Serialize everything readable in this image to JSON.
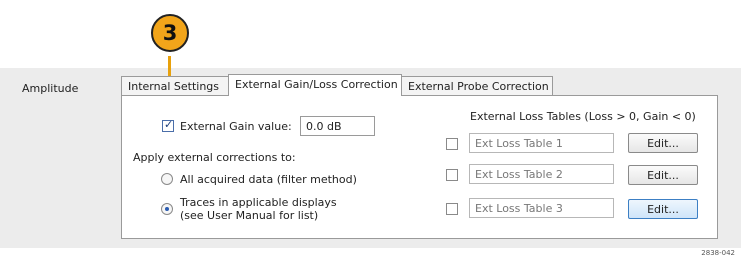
{
  "callout": {
    "number": "3"
  },
  "section": {
    "label": "Amplitude"
  },
  "tabs": [
    {
      "label": "Internal Settings"
    },
    {
      "label": "External Gain/Loss Correction"
    },
    {
      "label": "External Probe Correction"
    }
  ],
  "gain": {
    "checkbox_label": "External Gain value:",
    "value": "0.0 dB",
    "checked": true
  },
  "apply": {
    "heading": "Apply external corrections to:",
    "options": [
      {
        "label": "All acquired data (filter method)",
        "selected": false
      },
      {
        "label_line1": "Traces in applicable displays",
        "label_line2": "(see User Manual for list)",
        "selected": true
      }
    ]
  },
  "loss_tables": {
    "heading": "External Loss Tables (Loss > 0, Gain < 0)",
    "rows": [
      {
        "name": "Ext Loss Table 1",
        "button": "Edit..."
      },
      {
        "name": "Ext Loss Table 2",
        "button": "Edit..."
      },
      {
        "name": "Ext Loss Table 3",
        "button": "Edit..."
      }
    ]
  },
  "figure_id": "2838-042"
}
